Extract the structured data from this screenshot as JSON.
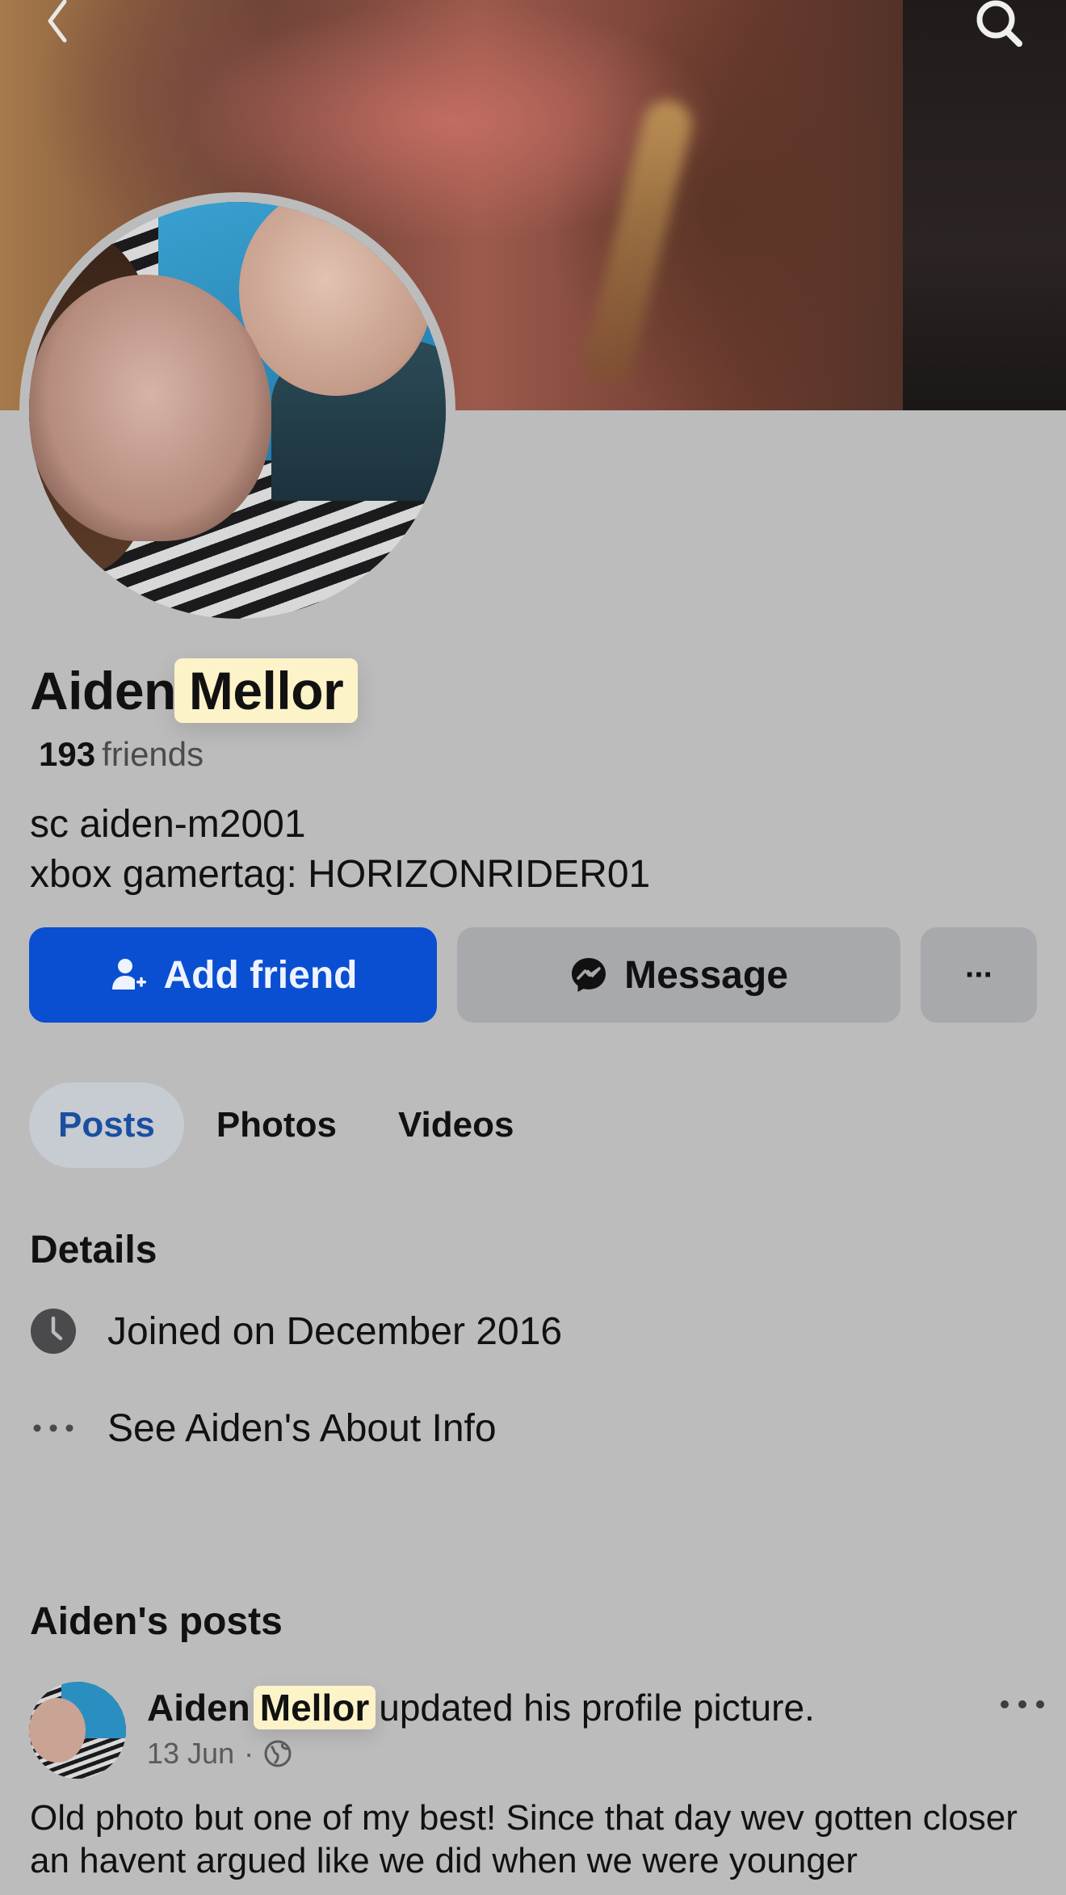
{
  "profile": {
    "first_name": "Aiden",
    "last_name": "Mellor",
    "friend_count": "193",
    "friends_label": "friends",
    "bio_line_1": "sc aiden-m2001",
    "bio_line_2": "xbox gamertag: HORIZONRIDER01"
  },
  "actions": {
    "add_friend": "Add friend",
    "message": "Message",
    "more": "···"
  },
  "tabs": [
    {
      "label": "Posts",
      "active": true
    },
    {
      "label": "Photos",
      "active": false
    },
    {
      "label": "Videos",
      "active": false
    }
  ],
  "details": {
    "title": "Details",
    "joined": "Joined on December 2016",
    "about": "See Aiden's About Info"
  },
  "posts": {
    "title": "Aiden's posts",
    "items": [
      {
        "author_first": "Aiden",
        "author_last": "Mellor",
        "action": "updated his profile picture.",
        "date": "13 Jun",
        "separator": "·",
        "text": "Old photo but one of my best! Since that day wev gotten closer an havent argued like we did when we were younger"
      }
    ]
  },
  "icons": {
    "back": "chevron-left-icon",
    "search": "search-icon",
    "add_friend": "person-add-icon",
    "message": "messenger-icon",
    "clock": "clock-icon",
    "more": "more-dots-icon",
    "globe": "globe-icon"
  },
  "colors": {
    "accent": "#0a4fd1",
    "background": "#bcbcbd",
    "highlight": "#fdf3c8"
  }
}
